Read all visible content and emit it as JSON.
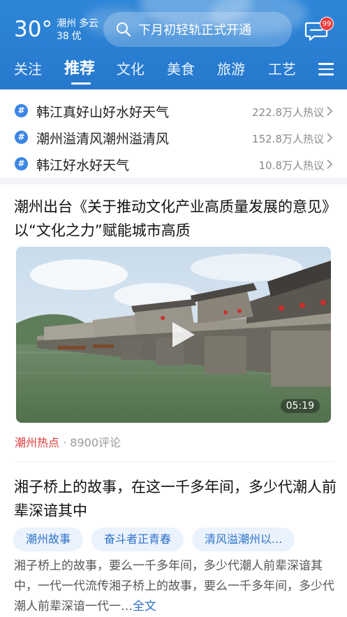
{
  "header": {
    "temperature": "30°",
    "city": "潮州",
    "condition": "多云",
    "aqi_value": "38",
    "aqi_label": "优",
    "search_text": "下月初轻轨正式开通",
    "message_badge": "99"
  },
  "tabs": [
    {
      "label": "关注"
    },
    {
      "label": "推荐",
      "active": true
    },
    {
      "label": "文化"
    },
    {
      "label": "美食"
    },
    {
      "label": "旅游"
    },
    {
      "label": "工艺"
    }
  ],
  "hot_topics": [
    {
      "title": "韩江真好山好水好天气",
      "heat": "222.8万人热议"
    },
    {
      "title": "潮州溢清风潮州溢清风",
      "heat": "152.8万人热议"
    },
    {
      "title": "韩江好水好天气",
      "heat": "10.8万人热议"
    }
  ],
  "article1": {
    "title": "潮州出台《关于推动文化产业高质量发展的意见》以“文化之力”赋能城市高质",
    "duration": "05:19",
    "source": "潮州热点",
    "comments": "8900评论"
  },
  "article2": {
    "title": "湘子桥上的故事，在这一千多年间，多少代潮人前辈深谙其中",
    "tags": [
      "潮州故事",
      "奋斗者正青春",
      "清风溢潮州以..."
    ],
    "summary": "湘子桥上的故事，要么一千多年间，多少代潮人前辈深谙其中，一代一代流传湘子桥上的故事，要么一千多年间，多少代潮人前辈深谙一代一…",
    "more_label": "全文"
  },
  "colors": {
    "header_blue": "#2a7fd3",
    "accent_blue": "#2f72c8",
    "source_red": "#e03a3a",
    "badge_red": "#f03b3b"
  }
}
